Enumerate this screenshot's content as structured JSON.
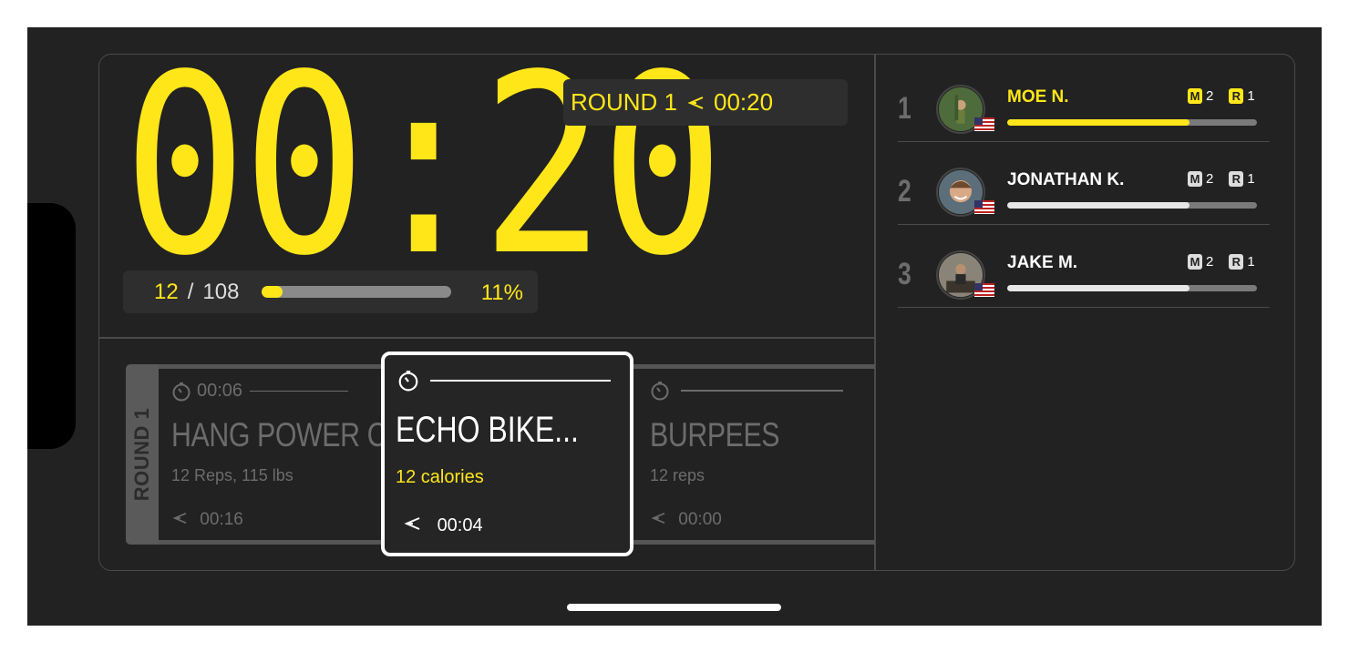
{
  "timer": {
    "display": "00:20"
  },
  "round_status": {
    "label": "ROUND 1",
    "split_icon": "split-arrow-icon",
    "time": "00:20"
  },
  "progress": {
    "current": "12",
    "separator": "/",
    "total": "108",
    "fraction": 0.11,
    "percent_label": "11%"
  },
  "round_tab": {
    "label": "ROUND 1"
  },
  "exercises": [
    {
      "timer_icon": "stopwatch-icon",
      "time": "00:06",
      "name": "HANG POWER C...",
      "detail": "12 Reps, 115 lbs",
      "split_icon": "split-arrow-icon",
      "split": "00:16"
    },
    {
      "timer_icon": "stopwatch-icon",
      "time": "",
      "name": "ECHO BIKE...",
      "detail": "12 calories",
      "split_icon": "split-arrow-icon",
      "split": "00:04"
    },
    {
      "timer_icon": "stopwatch-icon",
      "time": "",
      "name": "BURPEES",
      "detail": "12 reps",
      "split_icon": "split-arrow-icon",
      "split": "00:00"
    }
  ],
  "leaderboard": [
    {
      "rank": "1",
      "name": "MOE N.",
      "m_badge": "M",
      "m_count": "2",
      "r_badge": "R",
      "r_count": "1",
      "progress": 0.73,
      "flag_icon": "us-flag-icon"
    },
    {
      "rank": "2",
      "name": "JONATHAN K.",
      "m_badge": "M",
      "m_count": "2",
      "r_badge": "R",
      "r_count": "1",
      "progress": 0.73,
      "flag_icon": "us-flag-icon"
    },
    {
      "rank": "3",
      "name": "JAKE M.",
      "m_badge": "M",
      "m_count": "2",
      "r_badge": "R",
      "r_count": "1",
      "progress": 0.73,
      "flag_icon": "us-flag-icon"
    }
  ],
  "colors": {
    "accent": "#ffe619",
    "background": "#222222",
    "panel_border": "#4a4a4a"
  }
}
